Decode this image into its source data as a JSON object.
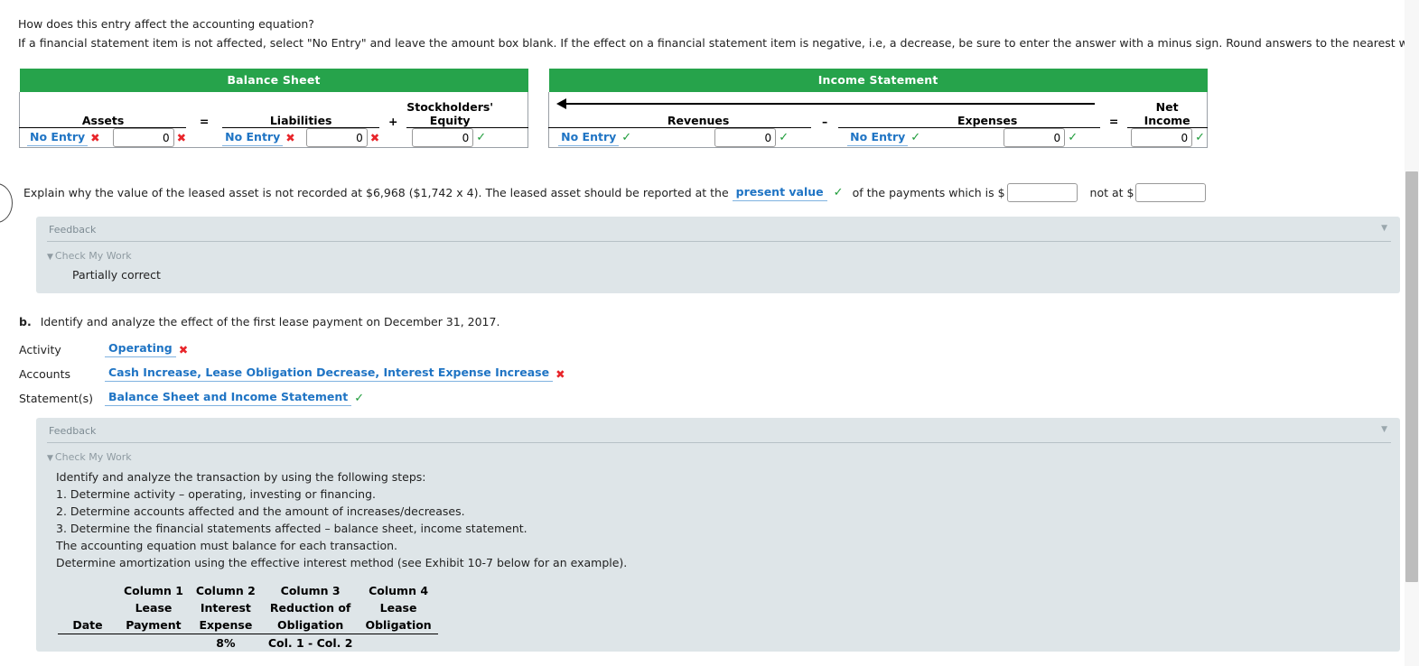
{
  "intro": {
    "line1": "How does this entry affect the accounting equation?",
    "line2": "If a financial statement item is not affected, select \"No Entry\" and leave the amount box blank. If the effect on a financial statement item is negative, i.e, a decrease, be sure to enter the answer with a minus sign. Round answers to the nearest whole dollar."
  },
  "equation": {
    "balance_sheet_header": "Balance Sheet",
    "income_statement_header": "Income Statement",
    "columns": {
      "assets": "Assets",
      "equals_1": "=",
      "liabilities": "Liabilities",
      "plus": "+",
      "stockholders": "Stockholders'",
      "equity": "Equity",
      "revenues": "Revenues",
      "minus": "–",
      "expenses": "Expenses",
      "equals_2": "=",
      "net": "Net",
      "income": "Income"
    },
    "cells": [
      {
        "name": "assets",
        "account": "No Entry",
        "account_mark": "x",
        "amount": "0",
        "amount_mark": "x"
      },
      {
        "name": "liabilities",
        "account": "No Entry",
        "account_mark": "x",
        "amount": "0",
        "amount_mark": "x"
      },
      {
        "name": "equity",
        "account": null,
        "account_mark": null,
        "amount": "0",
        "amount_mark": "check"
      },
      {
        "name": "revenues",
        "account": "No Entry",
        "account_mark": "check",
        "amount": "0",
        "amount_mark": "check"
      },
      {
        "name": "expenses",
        "account": "No Entry",
        "account_mark": "check",
        "amount": "0",
        "amount_mark": "check"
      },
      {
        "name": "net-income",
        "account": null,
        "account_mark": null,
        "amount": "0",
        "amount_mark": "check"
      }
    ],
    "header_color": "#26a34b",
    "correct_color": "#1e9c3a",
    "incorrect_color": "#e8252a",
    "link_color": "#1f74c4"
  },
  "explain": {
    "text_before": "Explain why the value of the leased asset is not recorded at $6,968 ($1,742 x 4). The leased asset should be reported at the",
    "dropdown_value": "present value",
    "dropdown_mark": "check",
    "text_middle": "of the payments which is $",
    "input1_value": "",
    "text_after": "not at $",
    "input2_value": ""
  },
  "feedback_a": {
    "title": "Feedback",
    "check_my_work": "Check My Work",
    "result": "Partially correct",
    "collapse_icon": "chevron-down-icon"
  },
  "section_b": {
    "label": "b.",
    "prompt": "Identify and analyze the effect of the first lease payment on December 31, 2017.",
    "rows": [
      {
        "label": "Activity",
        "value": "Operating",
        "mark": "x"
      },
      {
        "label": "Accounts",
        "value": "Cash Increase, Lease Obligation Decrease, Interest Expense Increase",
        "mark": "x"
      },
      {
        "label": "Statement(s)",
        "value": "Balance Sheet and Income Statement",
        "mark": "check"
      }
    ]
  },
  "feedback_b": {
    "title": "Feedback",
    "check_my_work": "Check My Work",
    "collapse_icon": "chevron-down-icon",
    "lines": [
      "Identify and analyze the transaction by using the following steps:",
      "1. Determine activity – operating, investing or financing.",
      "2. Determine accounts affected and the amount of increases/decreases.",
      "3. Determine the financial statements affected – balance sheet, income statement.",
      "The accounting equation must balance for each transaction.",
      "Determine amortization using the effective interest method (see Exhibit 10-7 below for an example)."
    ]
  },
  "amortization_table": {
    "header_row_1": [
      "",
      "Column 1",
      "Column 2",
      "Column 3",
      "Column 4"
    ],
    "header_row_2": [
      "",
      "Lease",
      "Interest",
      "Reduction of",
      "Lease"
    ],
    "header_row_3": [
      "Date",
      "Payment",
      "Expense",
      "Obligation",
      "Obligation"
    ],
    "note_row": [
      "",
      "",
      "8%",
      "Col. 1 - Col. 2",
      ""
    ]
  },
  "scrollbar": {
    "name": "vertical-scrollbar"
  }
}
